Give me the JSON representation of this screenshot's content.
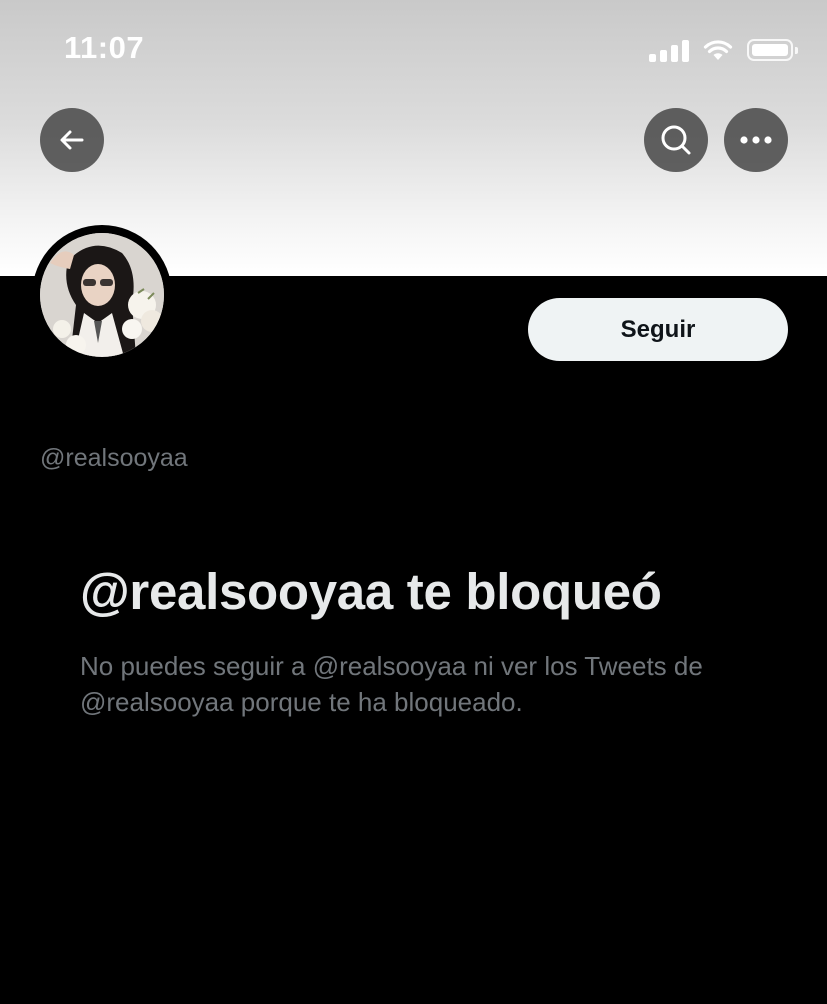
{
  "status_bar": {
    "time": "11:07",
    "icons": [
      "cellular-signal-icon",
      "wifi-icon",
      "battery-icon"
    ]
  },
  "nav": {
    "back_icon": "arrow-left-icon",
    "search_icon": "search-icon",
    "more_icon": "more-horizontal-icon"
  },
  "profile": {
    "handle": "@realsooyaa",
    "follow_label": "Seguir",
    "avatar": "profile-photo"
  },
  "blocked": {
    "title": "@realsooyaa te bloqueó",
    "description": "No puedes seguir a @realsooyaa ni ver los Tweets de @realsooyaa porque te ha bloqueado."
  },
  "colors": {
    "background": "#000000",
    "primary_text": "#e7e9ea",
    "secondary_text": "#71767b",
    "follow_button_bg": "#eff3f4"
  }
}
